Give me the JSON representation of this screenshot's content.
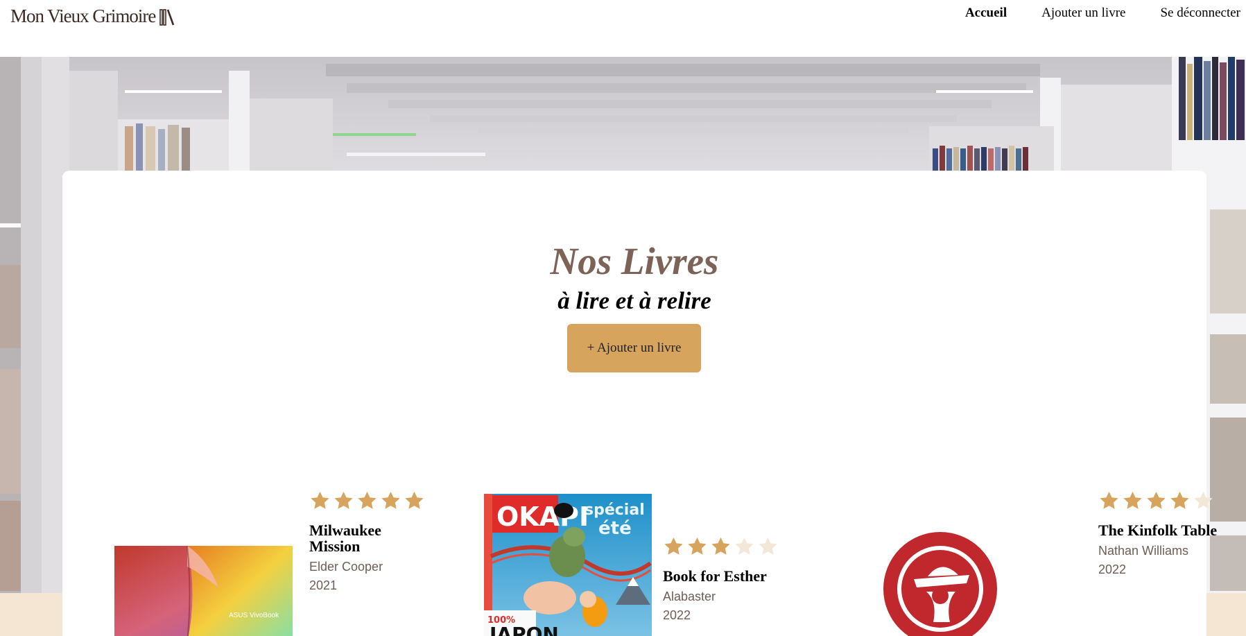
{
  "header": {
    "logo_text": "Mon Vieux Grimoire",
    "nav": [
      {
        "label": "Accueil",
        "active": true
      },
      {
        "label": "Ajouter un livre",
        "active": false
      },
      {
        "label": "Se déconnecter",
        "active": false
      }
    ]
  },
  "hero": {
    "title": "Nos Livres",
    "subtitle": "à lire et à relire",
    "add_button": "+ Ajouter un livre"
  },
  "books": [
    {
      "title": "Milwaukee Mission",
      "author": "Elder Cooper",
      "year": "2021",
      "rating": 5,
      "cover_text": "ASUS VivoBook"
    },
    {
      "title": "Book for Esther",
      "author": "Alabaster",
      "year": "2022",
      "rating": 3,
      "cover_text": "OKAPI"
    },
    {
      "title": "The Kinfolk Table",
      "author": "Nathan Williams",
      "year": "2022",
      "rating": 4,
      "cover_text": ""
    }
  ],
  "colors": {
    "accent": "#d6a45d",
    "title_brown": "#7d6258",
    "star_filled": "#d6a45d",
    "star_empty": "#f3e8d8",
    "footer_band": "#f4e6d2"
  },
  "icons": {
    "logo": "books-icon",
    "rating": "star-icon"
  }
}
